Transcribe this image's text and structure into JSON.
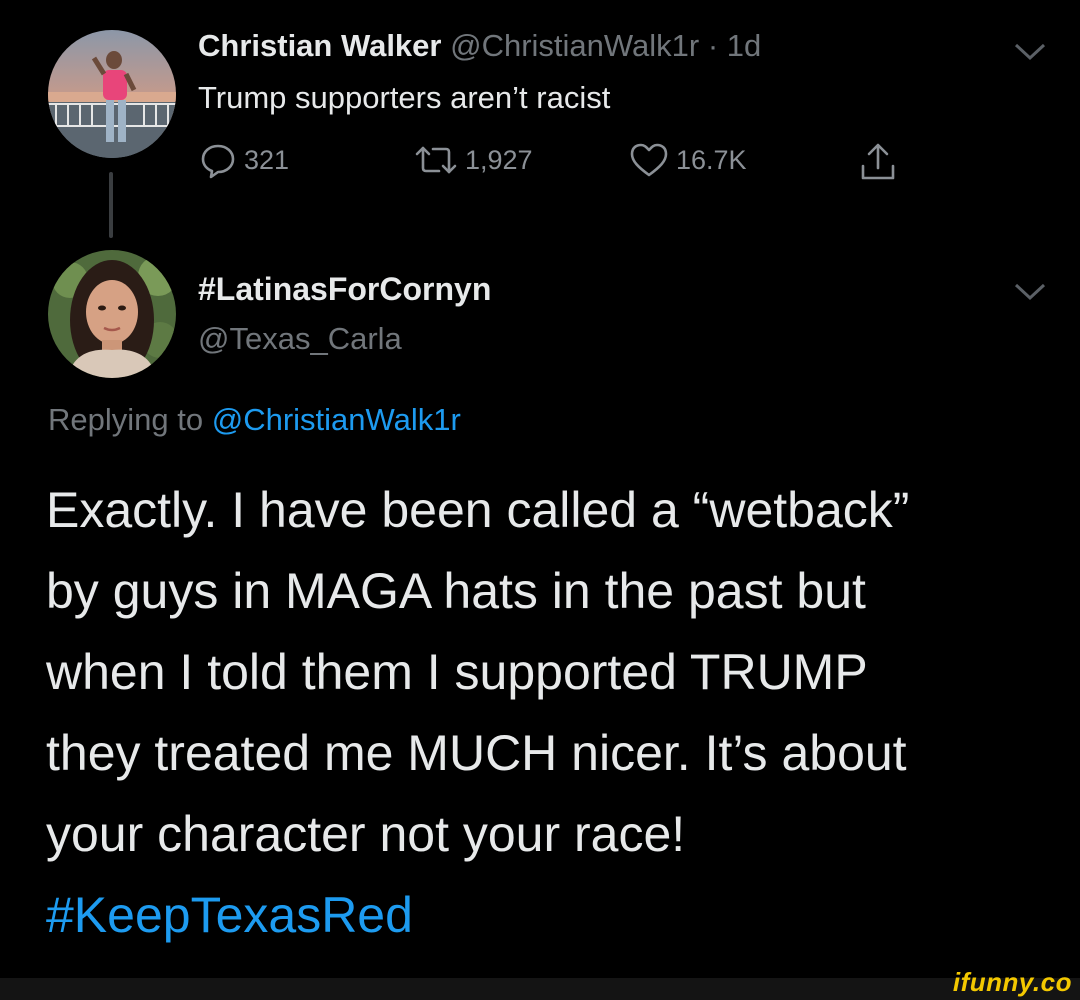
{
  "tweet1": {
    "name": "Christian Walker",
    "handle": "@ChristianWalk1r",
    "separator": "·",
    "time": "1d",
    "text": "Trump supporters aren’t racist",
    "reply_count": "321",
    "retweet_count": "1,927",
    "like_count": "16.7K"
  },
  "tweet2": {
    "name": "#LatinasForCornyn",
    "handle": "@Texas_Carla",
    "replying_label": "Replying to",
    "replying_to": "@ChristianWalk1r",
    "lines": [
      "Exactly. I have been called a “wetback”",
      "by guys in MAGA hats in the past but",
      "when I told them I supported TRUMP",
      "they treated me MUCH nicer. It’s about",
      "your character not your race!"
    ],
    "hashtag": "#KeepTexasRed"
  },
  "watermark": "ifunny.co",
  "colors": {
    "background": "#000000",
    "link": "#1d9bf0",
    "muted": "#71767b"
  },
  "icons": [
    "reply-icon",
    "retweet-icon",
    "like-icon",
    "share-icon",
    "chevron-down-icon"
  ]
}
